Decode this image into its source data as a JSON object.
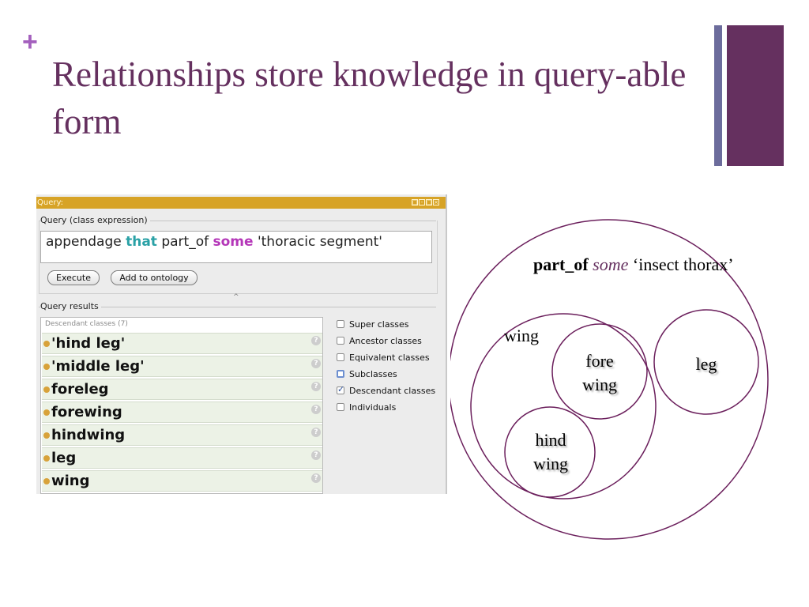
{
  "slide": {
    "bullet": "+",
    "title": "Relationships store knowledge in query-able form"
  },
  "query_panel": {
    "title": "Query:",
    "window_buttons": [
      "restore-icon",
      "minimize-icon",
      "maximize-icon",
      "close-icon"
    ],
    "expression_group_label": "Query (class expression)",
    "expression": {
      "part1": "appendage ",
      "kw_that": "that",
      "part2": " part_of ",
      "kw_some": "some",
      "part3": " 'thoracic segment'"
    },
    "execute_label": "Execute",
    "add_to_ontology_label": "Add to ontology",
    "results_group_label": "Query results",
    "results_header": "Descendant classes (7)",
    "results": [
      "'hind leg'",
      "'middle leg'",
      "foreleg",
      "forewing",
      "hindwing",
      "leg",
      "wing"
    ],
    "options": [
      {
        "label": "Super classes",
        "checked": false
      },
      {
        "label": "Ancestor classes",
        "checked": false
      },
      {
        "label": "Equivalent classes",
        "checked": false
      },
      {
        "label": "Subclasses",
        "checked": false
      },
      {
        "label": "Descendant classes",
        "checked": true
      },
      {
        "label": "Individuals",
        "checked": false
      }
    ],
    "colors": {
      "titlebar": "#d7a326",
      "keyword_that": "#2aa1a6",
      "keyword_some": "#b436b8",
      "result_dot": "#d8a23a"
    }
  },
  "diagram": {
    "outer_label_bold": "part_of",
    "outer_label_italic": "some",
    "outer_label_rest": "‘insect thorax’",
    "wing": "wing",
    "fore_wing": "fore wing",
    "hind_wing": "hind wing",
    "leg": "leg",
    "circle_color": "#6b1f5c"
  },
  "colors": {
    "title": "#65305f",
    "accent_plus": "#a35fbd",
    "bar_thin": "#6c6c9c",
    "bar_wide": "#65305f"
  }
}
